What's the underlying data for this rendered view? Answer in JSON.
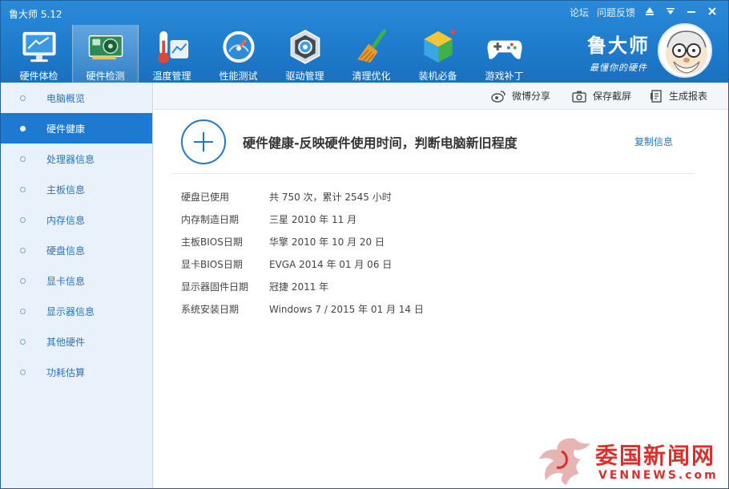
{
  "app": {
    "title": "鲁大师 5.12"
  },
  "top_links": {
    "forum": "论坛",
    "feedback": "问题反馈"
  },
  "nav": {
    "items": [
      {
        "label": "硬件体检",
        "icon": "monitor-icon"
      },
      {
        "label": "硬件检测",
        "icon": "graphics-card-icon"
      },
      {
        "label": "温度管理",
        "icon": "thermometer-icon"
      },
      {
        "label": "性能测试",
        "icon": "speedometer-icon"
      },
      {
        "label": "驱动管理",
        "icon": "driver-gear-icon"
      },
      {
        "label": "清理优化",
        "icon": "broom-icon"
      },
      {
        "label": "装机必备",
        "icon": "cube-icon"
      },
      {
        "label": "游戏补丁",
        "icon": "gamepad-icon"
      }
    ],
    "active_index": 1
  },
  "brand": {
    "name": "鲁大师",
    "slogan": "最懂你的硬件"
  },
  "sidebar": {
    "items": [
      {
        "label": "电脑概览"
      },
      {
        "label": "硬件健康"
      },
      {
        "label": "处理器信息"
      },
      {
        "label": "主板信息"
      },
      {
        "label": "内存信息"
      },
      {
        "label": "硬盘信息"
      },
      {
        "label": "显卡信息"
      },
      {
        "label": "显示器信息"
      },
      {
        "label": "其他硬件"
      },
      {
        "label": "功耗估算"
      }
    ],
    "active_index": 1
  },
  "toolbar": {
    "weibo_share": "微博分享",
    "save_screenshot": "保存截屏",
    "generate_report": "生成报表"
  },
  "content": {
    "headline": "硬件健康-反映硬件使用时间，判断电脑新旧程度",
    "copy_info": "复制信息",
    "rows": [
      {
        "key": "硬盘已使用",
        "value": "共 750 次，累计 2545 小时"
      },
      {
        "key": "内存制造日期",
        "value": "三星 2010 年 11 月"
      },
      {
        "key": "主板BIOS日期",
        "value": "华擎 2010 年 10 月 20 日"
      },
      {
        "key": "显卡BIOS日期",
        "value": "EVGA 2014 年 01 月 06 日"
      },
      {
        "key": "显示器固件日期",
        "value": "冠捷 2011 年"
      },
      {
        "key": "系统安装日期",
        "value": "Windows 7 / 2015 年 01 月 14 日"
      }
    ]
  },
  "watermark": {
    "text": "委国新闻网",
    "sub": "VENNEWS.com"
  },
  "colors": {
    "header": "#1f7ccd",
    "accent": "#2476c6",
    "sidebar_bg": "#e9f2fa",
    "watermark": "#d9302c"
  }
}
